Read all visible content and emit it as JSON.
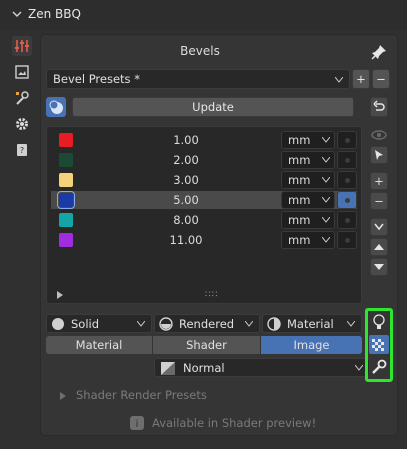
{
  "header": {
    "title": "Zen BBQ"
  },
  "panel": {
    "title": "Bevels",
    "presets_label": "Bevel Presets *",
    "update_label": "Update"
  },
  "rows": [
    {
      "color": "#e81c23",
      "value": "1.00",
      "unit": "mm",
      "selected": false
    },
    {
      "color": "#1b4a34",
      "value": "2.00",
      "unit": "mm",
      "selected": false
    },
    {
      "color": "#f5d27a",
      "value": "3.00",
      "unit": "mm",
      "selected": false
    },
    {
      "color": "#1a3aa8",
      "value": "5.00",
      "unit": "mm",
      "selected": true
    },
    {
      "color": "#12a6a6",
      "value": "8.00",
      "unit": "mm",
      "selected": false
    },
    {
      "color": "#a22ce0",
      "value": "11.00",
      "unit": "mm",
      "selected": false
    }
  ],
  "display": {
    "solid": "Solid",
    "rendered": "Rendered",
    "material": "Material"
  },
  "tabs": {
    "material": "Material",
    "shader": "Shader",
    "image": "Image",
    "active": "Image"
  },
  "blend": {
    "value": "Normal"
  },
  "shader_presets": {
    "label": "Shader Render Presets",
    "note": "Available in Shader preview!"
  },
  "colors": {
    "accent": "#4772b3",
    "highlight": "#2ee62e"
  }
}
